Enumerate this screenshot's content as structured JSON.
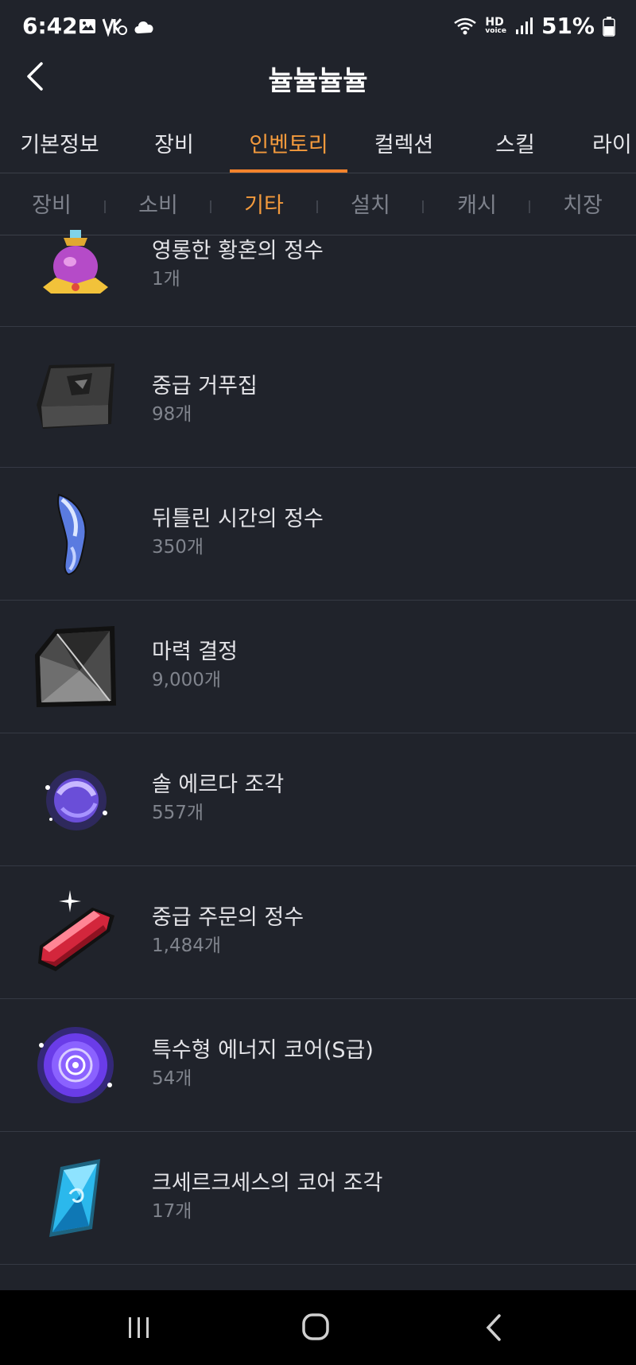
{
  "status_bar": {
    "time": "6:42",
    "hd_label": "HD",
    "voice_label": "voice",
    "battery_percent": "51%"
  },
  "header": {
    "title": "뉼뉼뉼뉼"
  },
  "main_tabs": [
    {
      "label": "기본정보",
      "active": false
    },
    {
      "label": "장비",
      "active": false
    },
    {
      "label": "인벤토리",
      "active": true
    },
    {
      "label": "컬렉션",
      "active": false
    },
    {
      "label": "스킬",
      "active": false
    },
    {
      "label": "라이",
      "active": false
    }
  ],
  "sub_tabs": [
    {
      "label": "장비",
      "active": false
    },
    {
      "label": "소비",
      "active": false
    },
    {
      "label": "기타",
      "active": true
    },
    {
      "label": "설치",
      "active": false
    },
    {
      "label": "캐시",
      "active": false
    },
    {
      "label": "치장",
      "active": false
    }
  ],
  "items": [
    {
      "name": "영롱한 황혼의 정수",
      "count": "1개",
      "icon": "potion-icon"
    },
    {
      "name": "중급 거푸집",
      "count": "98개",
      "icon": "mold-icon"
    },
    {
      "name": "뒤틀린 시간의 정수",
      "count": "350개",
      "icon": "twisted-time-icon"
    },
    {
      "name": "마력 결정",
      "count": "9,000개",
      "icon": "magic-crystal-icon"
    },
    {
      "name": "솔 에르다 조각",
      "count": "557개",
      "icon": "sol-erda-icon"
    },
    {
      "name": "중급 주문의 정수",
      "count": "1,484개",
      "icon": "red-crystal-icon"
    },
    {
      "name": "특수형 에너지 코어(S급)",
      "count": "54개",
      "icon": "energy-core-icon"
    },
    {
      "name": "크세르크세스의 코어 조각",
      "count": "17개",
      "icon": "blue-core-icon"
    }
  ],
  "colors": {
    "background": "#20232b",
    "accent": "#f3832c",
    "text_muted": "#80848d"
  }
}
